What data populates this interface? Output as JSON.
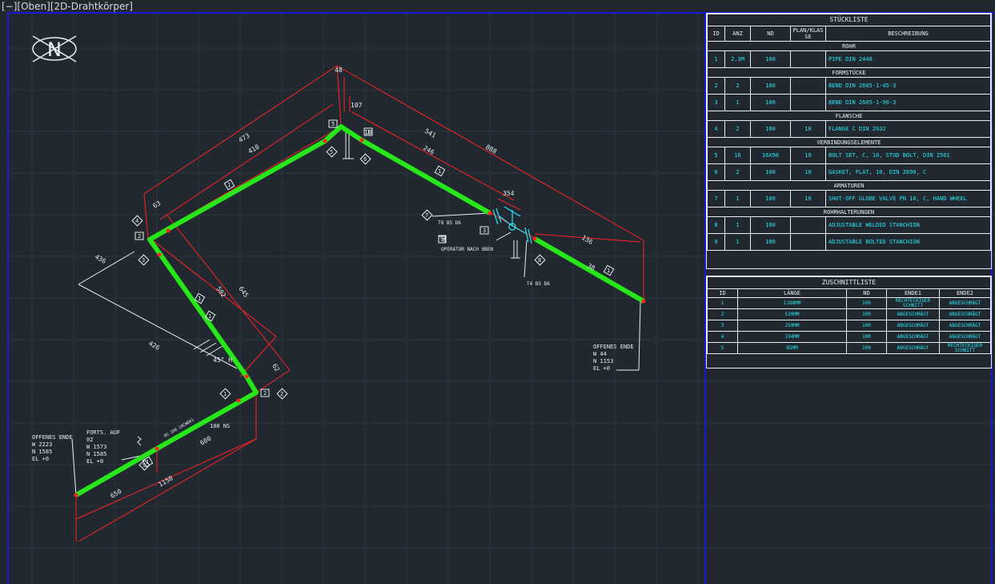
{
  "viewport": {
    "label": "[−][Oben][2D-Drahtkörper]"
  },
  "north_symbol": {
    "letter": "N"
  },
  "colors": {
    "background": "#212830",
    "pipe": "#27e619",
    "dimension": "#ff2222",
    "text": "#e8eef2",
    "table_value": "#27e6f2",
    "frame": "#1a18d6"
  },
  "drawing": {
    "dims": {
      "d48": "48",
      "d107": "107",
      "d473": "473",
      "d410": "410",
      "d63": "63",
      "d1b": "1B",
      "d541": "541",
      "d246": "246",
      "d888": "888",
      "d354": "354",
      "d136": "136",
      "d38": "38",
      "d436": "436",
      "d502": "502",
      "d645": "645",
      "d426": "426",
      "d62": "62",
      "d45h": "45° H",
      "d600": "600",
      "d1150": "1150",
      "d650": "650"
    },
    "labels": {
      "100ns": "100 NS",
      "pipe_id": "05-100-10CWD01",
      "t8": "T8 B5 D6",
      "t4": "T4 B5 D6",
      "operator_1": "7",
      "operator_2": "OPERATOR NACH OBEN",
      "fort_1": "FORTS. AUF",
      "fort_2": "02",
      "fort_3": "W 1573",
      "fort_4": "N 1585",
      "fort_5": "EL +0"
    },
    "open_end_left": {
      "l1": "OFFENES ENDE",
      "l2": "W 2223",
      "l3": "N 1585",
      "l4": "EL +0"
    },
    "open_end_right": {
      "l1": "OFFENES ENDE",
      "l2": "W 44",
      "l3": "N 1153",
      "l4": "EL +0"
    },
    "tags": {
      "t1": "1",
      "t2": "2",
      "t3": "3",
      "t4": "4",
      "t5": "5",
      "t6": "6",
      "t7": "7",
      "t8": "8",
      "t9": "9",
      "box2a": "2",
      "box2b": "2",
      "box3": "3",
      "box5": "5",
      "box6": "6",
      "box1a": "1",
      "box1b": "1",
      "box1c": "1",
      "box1d": "1",
      "box1e": "1",
      "box1f": "1",
      "box1g": "1",
      "box9": "9"
    }
  },
  "stueckliste": {
    "title": "STÜCKLISTE",
    "headers": [
      "ID",
      "ANZ",
      "ND",
      "PLAN/KLASSE",
      "BESCHREIBUNG"
    ],
    "groups": [
      {
        "name": "ROHR",
        "rows": [
          {
            "id": "1",
            "anz": "2.3M",
            "nd": "100",
            "plan": "",
            "desc": "PIPE DIN 2448"
          }
        ]
      },
      {
        "name": "FORMSTÜCKE",
        "rows": [
          {
            "id": "2",
            "anz": "2",
            "nd": "100",
            "plan": "",
            "desc": "BEND DIN 2605-1-45-3"
          },
          {
            "id": "3",
            "anz": "1",
            "nd": "100",
            "plan": "",
            "desc": "BEND DIN 2605-1-90-3"
          }
        ]
      },
      {
        "name": "FLANSCHE",
        "rows": [
          {
            "id": "4",
            "anz": "2",
            "nd": "100",
            "plan": "10",
            "desc": "FLANGE C DIN 2632"
          }
        ]
      },
      {
        "name": "VERBINDUNGSELEMENTE",
        "rows": [
          {
            "id": "5",
            "anz": "16",
            "nd": "16X90",
            "plan": "10",
            "desc": "BOLT SET, C, 10, STUD BOLT, DIN 2501"
          },
          {
            "id": "6",
            "anz": "2",
            "nd": "100",
            "plan": "10",
            "desc": "GASKET, FLAT, 10, DIN 2690, C"
          }
        ]
      },
      {
        "name": "ARMATUREN",
        "rows": [
          {
            "id": "7",
            "anz": "1",
            "nd": "100",
            "plan": "10",
            "desc": "SHUT-OFF GLOBE VALVE PN 10, C, HAND WHEEL"
          }
        ]
      },
      {
        "name": "ROHRHALTERUNGEN",
        "rows": [
          {
            "id": "8",
            "anz": "1",
            "nd": "100",
            "plan": "",
            "desc": "ADJUSTABLE WELDED STANCHION"
          },
          {
            "id": "9",
            "anz": "1",
            "nd": "100",
            "plan": "",
            "desc": "ADJUSTABLE BOLTED STANCHION"
          }
        ]
      }
    ]
  },
  "zuschnittliste": {
    "title": "ZUSCHNITTLISTE",
    "headers": [
      "ID",
      "LÄNGE",
      "ND",
      "ENDE1",
      "ENDE2"
    ],
    "rows": [
      {
        "id": "1",
        "laenge": "1188MM",
        "nd": "100",
        "ende1": "RECHTECKIGER SCHNITT",
        "ende2": "ABGESCHRÄGT"
      },
      {
        "id": "2",
        "laenge": "520MM",
        "nd": "100",
        "ende1": "ABGESCHRÄGT",
        "ende2": "ABGESCHRÄGT"
      },
      {
        "id": "3",
        "laenge": "250MM",
        "nd": "100",
        "ende1": "ABGESCHRÄGT",
        "ende2": "ABGESCHRÄGT"
      },
      {
        "id": "4",
        "laenge": "194MM",
        "nd": "100",
        "ende1": "ABGESCHRÄGT",
        "ende2": "ABGESCHRÄGT"
      },
      {
        "id": "5",
        "laenge": "85MM",
        "nd": "100",
        "ende1": "ABGESCHRÄGT",
        "ende2": "RECHTECKIGER SCHNITT"
      }
    ]
  }
}
